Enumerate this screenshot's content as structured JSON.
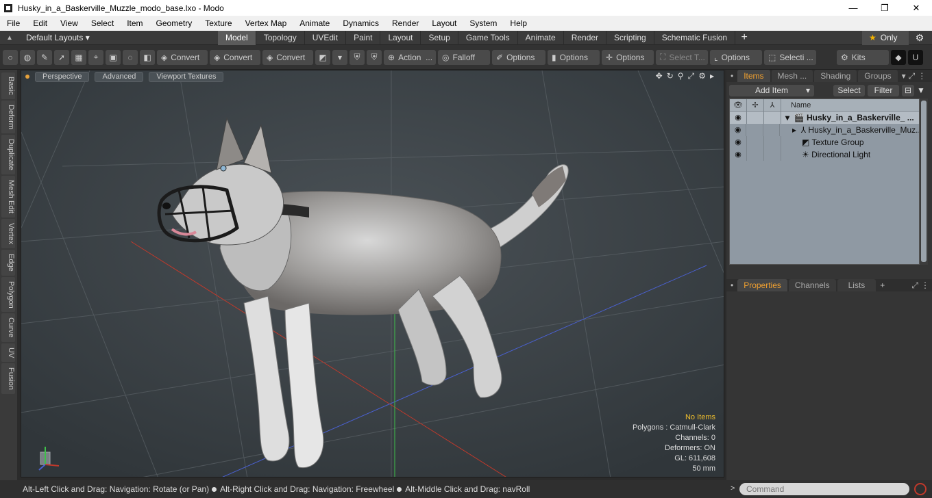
{
  "window": {
    "title": "Husky_in_a_Baskerville_Muzzle_modo_base.lxo - Modo",
    "minimize": "—",
    "maximize": "❐",
    "close": "✕"
  },
  "menu": [
    "File",
    "Edit",
    "View",
    "Select",
    "Item",
    "Geometry",
    "Texture",
    "Vertex Map",
    "Animate",
    "Dynamics",
    "Render",
    "Layout",
    "System",
    "Help"
  ],
  "layoutbar": {
    "layouts_label": "Default Layouts ▾",
    "tabs": [
      "Model",
      "Topology",
      "UVEdit",
      "Paint",
      "Layout",
      "Setup",
      "Game Tools",
      "Animate",
      "Render",
      "Scripting",
      "Schematic Fusion"
    ],
    "active_tab": "Model",
    "plus": "+",
    "only_label": "Only"
  },
  "toolbar": {
    "convert1": "Convert",
    "convert2": "Convert",
    "convert3": "Convert",
    "action": "Action",
    "action_more": "...",
    "falloff": "Falloff",
    "options1": "Options",
    "options2": "Options",
    "options3": "Options",
    "select_t": "Select T...",
    "options4": "Options",
    "selecti": "Selecti ...",
    "kits": "Kits"
  },
  "left_tabs": [
    "Basic",
    "Deform",
    "Duplicate",
    "Mesh Edit",
    "Vertex",
    "Edge",
    "Polygon",
    "Curve",
    "UV",
    "Fusion"
  ],
  "viewport": {
    "tabs": [
      "Perspective",
      "Advanced",
      "Viewport Textures"
    ],
    "stats": {
      "no_items": "No Items",
      "polygons": "Polygons : Catmull-Clark",
      "channels": "Channels: 0",
      "deformers": "Deformers: ON",
      "gl": "GL: 611,608",
      "size": "50 mm"
    }
  },
  "status": {
    "part1": "Alt-Left Click and Drag: Navigation: Rotate (or Pan)",
    "part2": "Alt-Right Click and Drag: Navigation: Freewheel",
    "part3": "Alt-Middle Click and Drag: navRoll"
  },
  "items_panel": {
    "tabs": [
      "Items",
      "Mesh ...",
      "Shading",
      "Groups"
    ],
    "add_item": "Add Item",
    "select": "Select",
    "filter": "Filter",
    "name_header": "Name",
    "rows": [
      {
        "name": "Husky_in_a_Baskerville_ ...",
        "icon": "scene-icon"
      },
      {
        "name": "Husky_in_a_Baskerville_Muz...",
        "icon": "mesh-icon"
      },
      {
        "name": "Texture Group",
        "icon": "texture-group-icon"
      },
      {
        "name": "Directional Light",
        "icon": "light-icon"
      }
    ]
  },
  "properties_panel": {
    "tabs": [
      "Properties",
      "Channels",
      "Lists"
    ],
    "plus": "+"
  },
  "command": {
    "placeholder": "Command"
  },
  "colors": {
    "accent": "#f0a030",
    "viewport_bg": "#3f464b",
    "list_bg": "#8f99a3"
  }
}
